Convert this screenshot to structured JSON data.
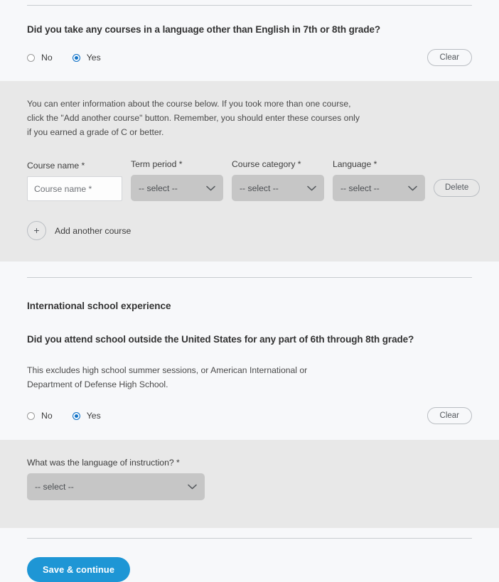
{
  "colors": {
    "page_bg": "#f7f8fa",
    "panel_bg": "#e8e8e8",
    "accent_blue": "#1e96d5",
    "radio_blue": "#1273c7",
    "select_bg": "#c6c6c6",
    "rule": "#c8ccd0"
  },
  "language_courses": {
    "question": "Did you take any courses in a language other than English in 7th or 8th grade?",
    "options": [
      {
        "label": "No",
        "selected": false
      },
      {
        "label": "Yes",
        "selected": true
      }
    ],
    "clear_label": "Clear",
    "panel": {
      "instructions": "You can enter information about the course below. If you took more than one course, click the \"Add another course\" button. Remember, you should enter these courses only if you earned a grade of C or better.",
      "fields": {
        "course_name": {
          "label": "Course name *",
          "placeholder": "Course name *",
          "value": ""
        },
        "term_period": {
          "label": "Term period *",
          "value": "-- select --"
        },
        "course_category": {
          "label": "Course category *",
          "value": "-- select --"
        },
        "language": {
          "label": "Language *",
          "value": "-- select --"
        }
      },
      "delete_label": "Delete",
      "add_another": {
        "icon_label": "+",
        "label": "Add another course"
      }
    }
  },
  "international": {
    "section_title": "International school experience",
    "question": "Did you attend school outside the United States for any part of 6th through 8th grade?",
    "help_text": "This excludes high school summer sessions, or American International or Department of Defense High School.",
    "options": [
      {
        "label": "No",
        "selected": false
      },
      {
        "label": "Yes",
        "selected": true
      }
    ],
    "clear_label": "Clear",
    "panel": {
      "language_of_instruction": {
        "label": "What was the language of instruction? *",
        "value": "-- select --"
      }
    }
  },
  "footer": {
    "save_label": "Save & continue"
  }
}
